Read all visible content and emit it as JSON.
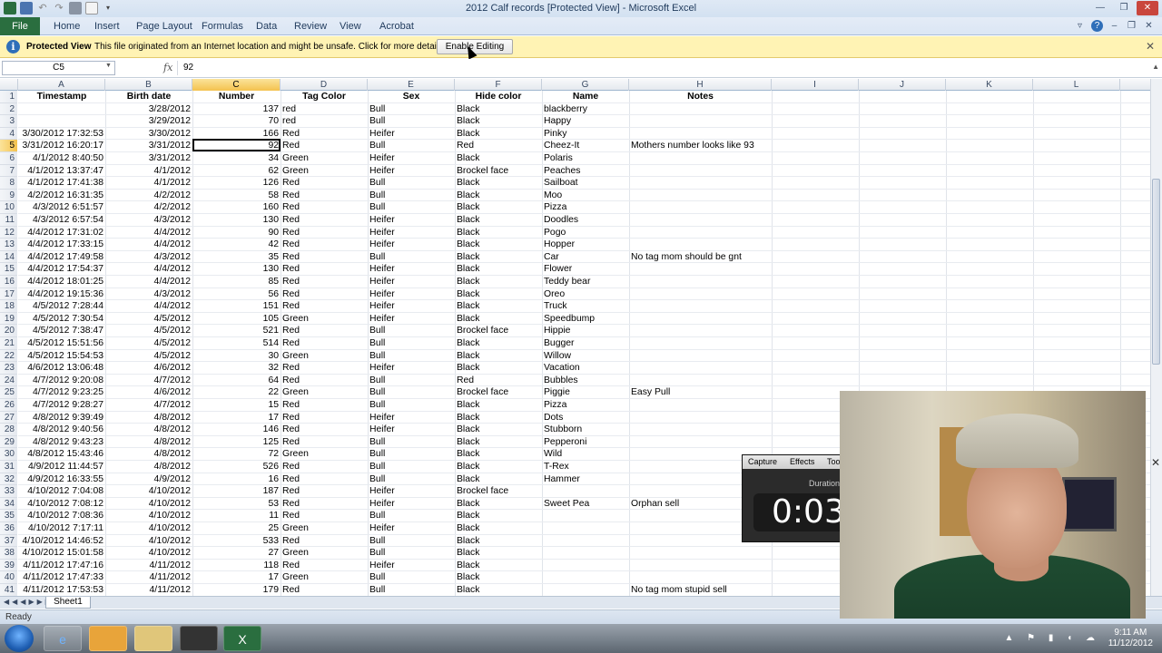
{
  "window": {
    "title": "2012 Calf records  [Protected View]  -  Microsoft Excel"
  },
  "ribbon": {
    "tabs": [
      "File",
      "Home",
      "Insert",
      "Page Layout",
      "Formulas",
      "Data",
      "Review",
      "View",
      "Acrobat"
    ]
  },
  "protected_view": {
    "title": "Protected View",
    "message": "This file originated from an Internet location and might be unsafe. Click for more details.",
    "button": "Enable Editing"
  },
  "formula_bar": {
    "name_box": "C5",
    "fx": "fx",
    "value": "92"
  },
  "sheet": {
    "column_letters": [
      "A",
      "B",
      "C",
      "D",
      "E",
      "F",
      "G",
      "H",
      "I",
      "J",
      "K",
      "L"
    ],
    "headers": [
      "Timestamp",
      "Birth date",
      "Number",
      "Tag Color",
      "Sex",
      "Hide color",
      "Name",
      "Notes"
    ],
    "rows": [
      [
        "",
        "3/28/2012",
        "137",
        "red",
        "Bull",
        "Black",
        "blackberry",
        ""
      ],
      [
        "",
        "3/29/2012",
        "70",
        "red",
        "Bull",
        "Black",
        "Happy",
        ""
      ],
      [
        "3/30/2012 17:32:53",
        "3/30/2012",
        "166",
        "Red",
        "Heifer",
        "Black",
        "Pinky",
        ""
      ],
      [
        "3/31/2012 16:20:17",
        "3/31/2012",
        "92",
        "Red",
        "Bull",
        "Red",
        "Cheez-It",
        "Mothers number looks like 93"
      ],
      [
        "4/1/2012 8:40:50",
        "3/31/2012",
        "34",
        "Green",
        "Heifer",
        "Black",
        "Polaris",
        ""
      ],
      [
        "4/1/2012 13:37:47",
        "4/1/2012",
        "62",
        "Green",
        "Heifer",
        "Brockel face",
        "Peaches",
        ""
      ],
      [
        "4/1/2012 17:41:38",
        "4/1/2012",
        "126",
        "Red",
        "Bull",
        "Black",
        "Sailboat",
        ""
      ],
      [
        "4/2/2012 16:31:35",
        "4/2/2012",
        "58",
        "Red",
        "Bull",
        "Black",
        "Moo",
        ""
      ],
      [
        "4/3/2012 6:51:57",
        "4/2/2012",
        "160",
        "Red",
        "Bull",
        "Black",
        "Pizza",
        ""
      ],
      [
        "4/3/2012 6:57:54",
        "4/3/2012",
        "130",
        "Red",
        "Heifer",
        "Black",
        "Doodles",
        ""
      ],
      [
        "4/4/2012 17:31:02",
        "4/4/2012",
        "90",
        "Red",
        "Heifer",
        "Black",
        "Pogo",
        ""
      ],
      [
        "4/4/2012 17:33:15",
        "4/4/2012",
        "42",
        "Red",
        "Heifer",
        "Black",
        "Hopper",
        ""
      ],
      [
        "4/4/2012 17:49:58",
        "4/3/2012",
        "35",
        "Red",
        "Bull",
        "Black",
        "Car",
        "No tag mom should be gnt"
      ],
      [
        "4/4/2012 17:54:37",
        "4/4/2012",
        "130",
        "Red",
        "Heifer",
        "Black",
        "Flower",
        ""
      ],
      [
        "4/4/2012 18:01:25",
        "4/4/2012",
        "85",
        "Red",
        "Heifer",
        "Black",
        "Teddy bear",
        ""
      ],
      [
        "4/4/2012 19:15:36",
        "4/3/2012",
        "56",
        "Red",
        "Heifer",
        "Black",
        "Oreo",
        ""
      ],
      [
        "4/5/2012 7:28:44",
        "4/4/2012",
        "151",
        "Red",
        "Heifer",
        "Black",
        "Truck",
        ""
      ],
      [
        "4/5/2012 7:30:54",
        "4/5/2012",
        "105",
        "Green",
        "Heifer",
        "Black",
        "Speedbump",
        ""
      ],
      [
        "4/5/2012 7:38:47",
        "4/5/2012",
        "521",
        "Red",
        "Bull",
        "Brockel face",
        "Hippie",
        ""
      ],
      [
        "4/5/2012 15:51:56",
        "4/5/2012",
        "514",
        "Red",
        "Bull",
        "Black",
        "Bugger",
        ""
      ],
      [
        "4/5/2012 15:54:53",
        "4/5/2012",
        "30",
        "Green",
        "Bull",
        "Black",
        "Willow",
        ""
      ],
      [
        "4/6/2012 13:06:48",
        "4/6/2012",
        "32",
        "Red",
        "Heifer",
        "Black",
        "Vacation",
        ""
      ],
      [
        "4/7/2012 9:20:08",
        "4/7/2012",
        "64",
        "Red",
        "Bull",
        "Red",
        "Bubbles",
        ""
      ],
      [
        "4/7/2012 9:23:25",
        "4/6/2012",
        "22",
        "Green",
        "Bull",
        "Brockel face",
        "Piggie",
        "Easy Pull"
      ],
      [
        "4/7/2012 9:28:27",
        "4/7/2012",
        "15",
        "Red",
        "Bull",
        "Black",
        "Pizza",
        ""
      ],
      [
        "4/8/2012 9:39:49",
        "4/8/2012",
        "17",
        "Red",
        "Heifer",
        "Black",
        "Dots",
        ""
      ],
      [
        "4/8/2012 9:40:56",
        "4/8/2012",
        "146",
        "Red",
        "Heifer",
        "Black",
        "Stubborn",
        ""
      ],
      [
        "4/8/2012 9:43:23",
        "4/8/2012",
        "125",
        "Red",
        "Bull",
        "Black",
        "Pepperoni",
        ""
      ],
      [
        "4/8/2012 15:43:46",
        "4/8/2012",
        "72",
        "Green",
        "Bull",
        "Black",
        "Wild",
        ""
      ],
      [
        "4/9/2012 11:44:57",
        "4/8/2012",
        "526",
        "Red",
        "Bull",
        "Black",
        "T-Rex",
        ""
      ],
      [
        "4/9/2012 16:33:55",
        "4/9/2012",
        "16",
        "Red",
        "Bull",
        "Black",
        "Hammer",
        ""
      ],
      [
        "4/10/2012 7:04:08",
        "4/10/2012",
        "187",
        "Red",
        "Heifer",
        "Brockel face",
        "",
        ""
      ],
      [
        "4/10/2012 7:08:12",
        "4/10/2012",
        "53",
        "Red",
        "Heifer",
        "Black",
        "Sweet Pea",
        "Orphan sell"
      ],
      [
        "4/10/2012 7:08:36",
        "4/10/2012",
        "11",
        "Red",
        "Bull",
        "Black",
        "",
        ""
      ],
      [
        "4/10/2012 7:17:11",
        "4/10/2012",
        "25",
        "Green",
        "Heifer",
        "Black",
        "",
        ""
      ],
      [
        "4/10/2012 14:46:52",
        "4/10/2012",
        "533",
        "Red",
        "Bull",
        "Black",
        "",
        ""
      ],
      [
        "4/10/2012 15:01:58",
        "4/10/2012",
        "27",
        "Green",
        "Bull",
        "Black",
        "",
        ""
      ],
      [
        "4/11/2012 17:47:16",
        "4/11/2012",
        "118",
        "Red",
        "Heifer",
        "Black",
        "",
        ""
      ],
      [
        "4/11/2012 17:47:33",
        "4/11/2012",
        "17",
        "Green",
        "Bull",
        "Black",
        "",
        ""
      ],
      [
        "4/11/2012 17:53:53",
        "4/11/2012",
        "179",
        "Red",
        "Bull",
        "Black",
        "",
        "No tag mom stupid sell"
      ]
    ],
    "selected_row": 5,
    "selected_col": "C",
    "sheet_tab": "Sheet1"
  },
  "status_bar": {
    "status": "Ready"
  },
  "capture_overlay": {
    "menu": [
      "Capture",
      "Effects",
      "Too"
    ],
    "duration_label": "Duration",
    "timer": "0:03:"
  },
  "taskbar": {
    "time": "9:11 AM",
    "date": "11/12/2012"
  },
  "colors": {
    "excel_green": "#2a6e3f",
    "protected_yellow": "#fff3b4",
    "selection_orange": "#f4c24e"
  }
}
